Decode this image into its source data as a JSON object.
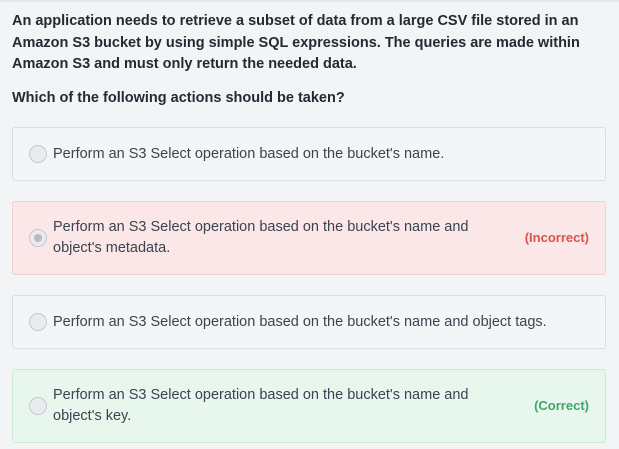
{
  "question": {
    "text": "An application needs to retrieve a subset of data from a large CSV file stored in an Amazon S3 bucket by using simple SQL expressions. The queries are made within Amazon S3 and must only return the needed data.",
    "prompt": "Which of the following actions should be taken?"
  },
  "options": [
    {
      "text": "Perform an S3 Select operation based on the bucket's name.",
      "verdict": "",
      "state": "default"
    },
    {
      "text": "Perform an S3 Select operation based on the bucket's name and object's metadata.",
      "verdict": "(Incorrect)",
      "state": "incorrect"
    },
    {
      "text": "Perform an S3 Select operation based on the bucket's name and object tags.",
      "verdict": "",
      "state": "default"
    },
    {
      "text": "Perform an S3 Select operation based on the bucket's name and object's key.",
      "verdict": "(Correct)",
      "state": "correct"
    }
  ],
  "colors": {
    "incorrect_bg": "#fbe7e7",
    "correct_bg": "#e8f7ee",
    "incorrect_text": "#d9534f",
    "correct_text": "#3fa56b"
  }
}
